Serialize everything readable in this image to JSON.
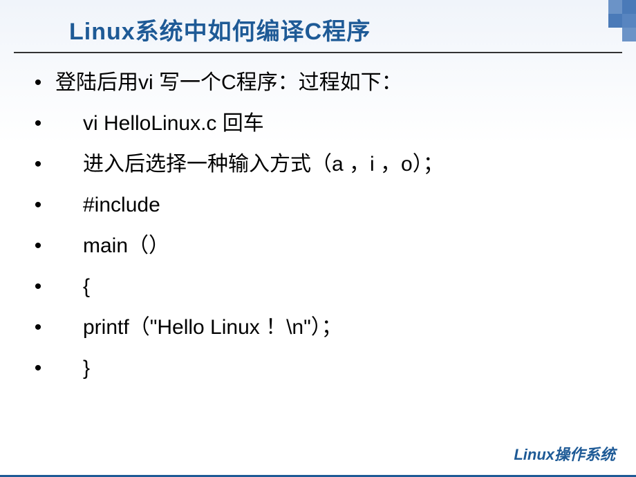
{
  "title": "Linux系统中如何编译C程序",
  "bullets": {
    "b0": "登陆后用vi 写一个C程序：过程如下：",
    "b1": "vi HelloLinux.c 回车",
    "b2": "进入后选择一种输入方式（a ，i ，o）；",
    "b3": "#include",
    "b4": "main（）",
    "b5": "{",
    "b6": "printf（\"Hello Linux ！\\n\"）；",
    "b7": "}"
  },
  "footer": "Linux操作系统"
}
